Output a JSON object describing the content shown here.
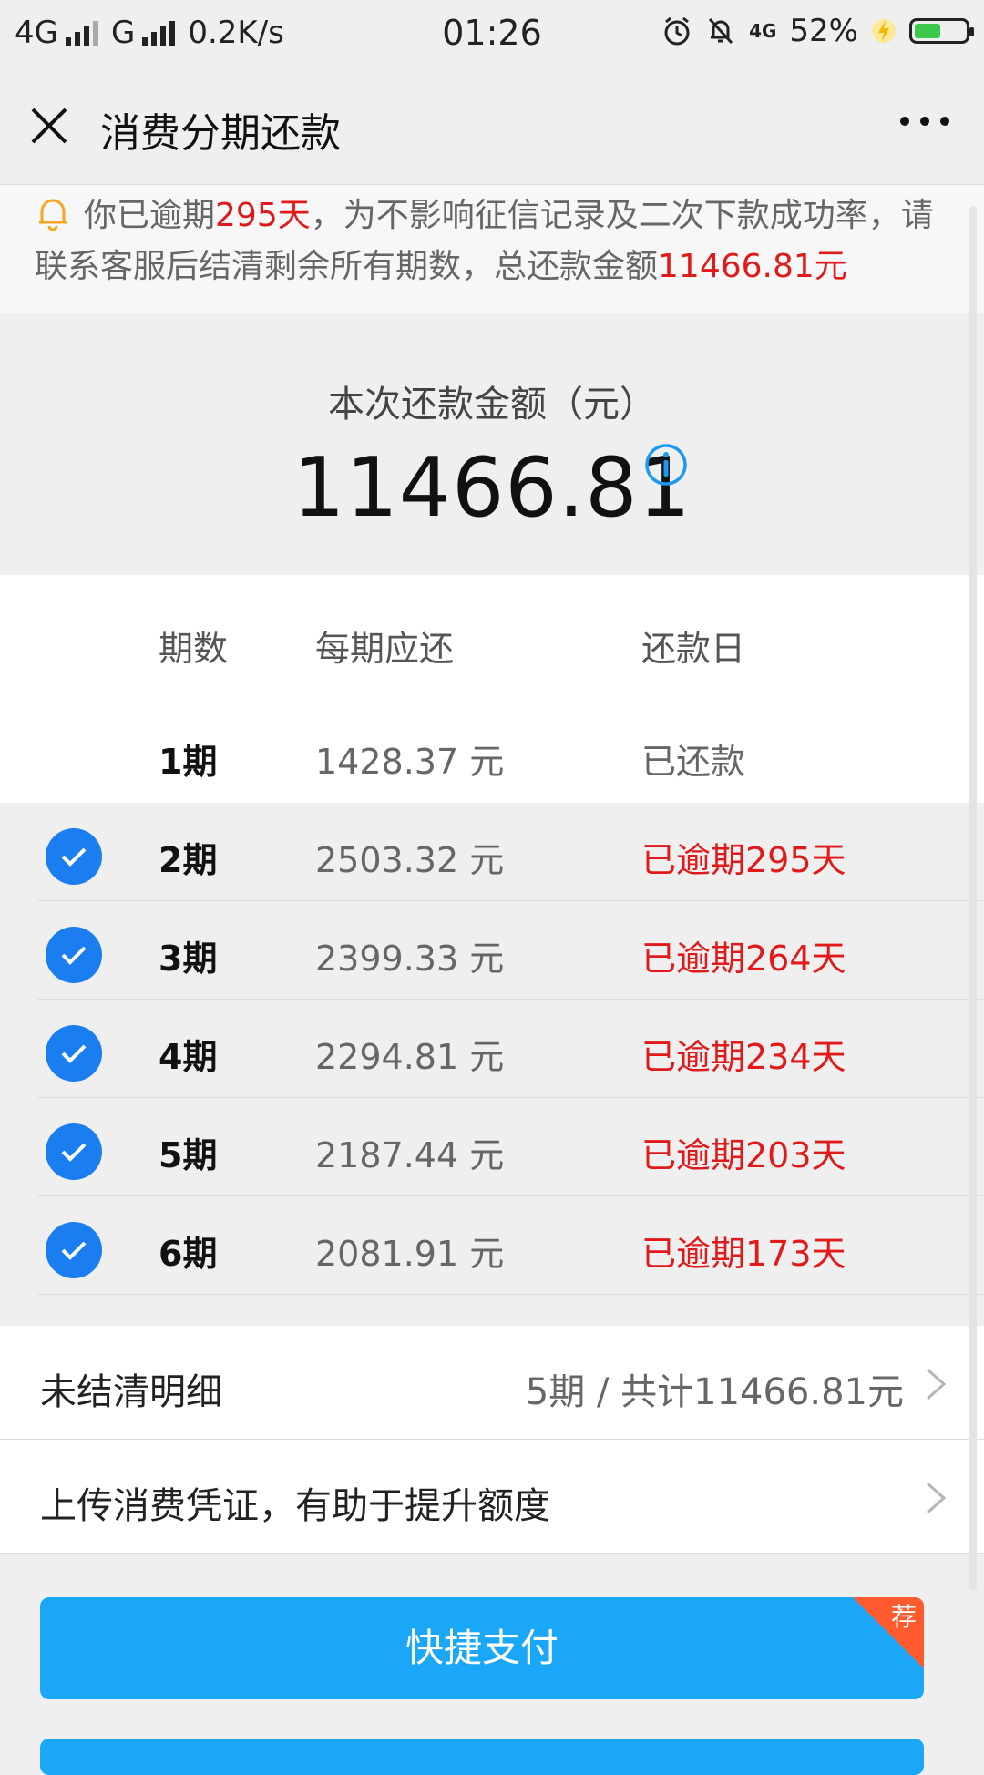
{
  "status_bar": {
    "network1": "4G",
    "network2": "G",
    "speed": "0.2K/s",
    "time": "01:26",
    "net_badge": "4G",
    "battery": "52%",
    "battery_level": 0.52
  },
  "nav": {
    "title": "消费分期还款",
    "close_icon": "close-icon",
    "more_icon": "more-icon"
  },
  "notice": {
    "prefix": "你已逾期",
    "days": "295天",
    "middle": "，为不影响征信记录及二次下款成功率，请联系客服后结清剩余所有期数，总还款金额",
    "total": "11466.81元"
  },
  "amount": {
    "label": "本次还款金额（元）",
    "value": "11466.81"
  },
  "table": {
    "headers": {
      "period": "期数",
      "amount": "每期应还",
      "due": "还款日"
    },
    "rows": [
      {
        "period": "1期",
        "amount": "1428.37 元",
        "status": "已还款",
        "overdue": false,
        "checked": false
      },
      {
        "period": "2期",
        "amount": "2503.32 元",
        "status": "已逾期295天",
        "overdue": true,
        "checked": true
      },
      {
        "period": "3期",
        "amount": "2399.33 元",
        "status": "已逾期264天",
        "overdue": true,
        "checked": true
      },
      {
        "period": "4期",
        "amount": "2294.81 元",
        "status": "已逾期234天",
        "overdue": true,
        "checked": true
      },
      {
        "period": "5期",
        "amount": "2187.44 元",
        "status": "已逾期203天",
        "overdue": true,
        "checked": true
      },
      {
        "period": "6期",
        "amount": "2081.91 元",
        "status": "已逾期173天",
        "overdue": true,
        "checked": true
      }
    ]
  },
  "details": {
    "unsettled_label": "未结清明细",
    "unsettled_value": "5期 / 共计11466.81元",
    "upload_label": "上传消费凭证，有助于提升额度"
  },
  "buttons": {
    "quick_pay": "快捷支付",
    "badge": "荐"
  },
  "colors": {
    "accent": "#1aa7f7",
    "check": "#1a7ef0",
    "overdue": "#e01a1a",
    "bell": "#f5a623"
  }
}
